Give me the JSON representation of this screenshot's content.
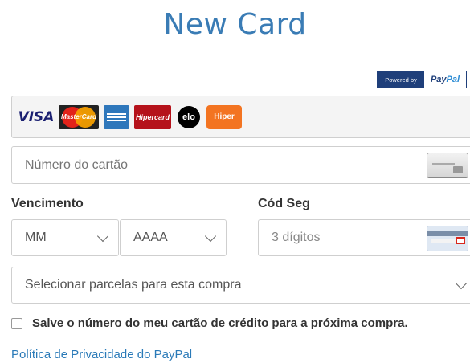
{
  "title": "New Card",
  "paypal_badge": {
    "powered_by": "Powered by",
    "brand_pay": "Pay",
    "brand_pal": "Pal"
  },
  "card_logos": [
    {
      "name": "visa",
      "label": "VISA"
    },
    {
      "name": "mastercard",
      "label": "MasterCard"
    },
    {
      "name": "amex",
      "label": ""
    },
    {
      "name": "hipercard",
      "label": "Hipercard"
    },
    {
      "name": "elo",
      "label": "elo"
    },
    {
      "name": "hiper",
      "label": "Hiper"
    }
  ],
  "card_number": {
    "placeholder": "Número do cartão"
  },
  "expiration": {
    "label": "Vencimento",
    "month_value": "MM",
    "year_value": "AAAA"
  },
  "security_code": {
    "label": "Cód Seg",
    "placeholder": "3 dígitos"
  },
  "installments": {
    "value": "Selecionar parcelas para esta compra"
  },
  "save_card": {
    "label": "Salve o número do meu cartão de crédito para a próxima compra.",
    "checked": false
  },
  "privacy_link": "Política de Privacidade do PayPal",
  "colors": {
    "title": "#3a7cb5",
    "link": "#2a7ab8",
    "paypal_navy": "#1f3f7a"
  }
}
